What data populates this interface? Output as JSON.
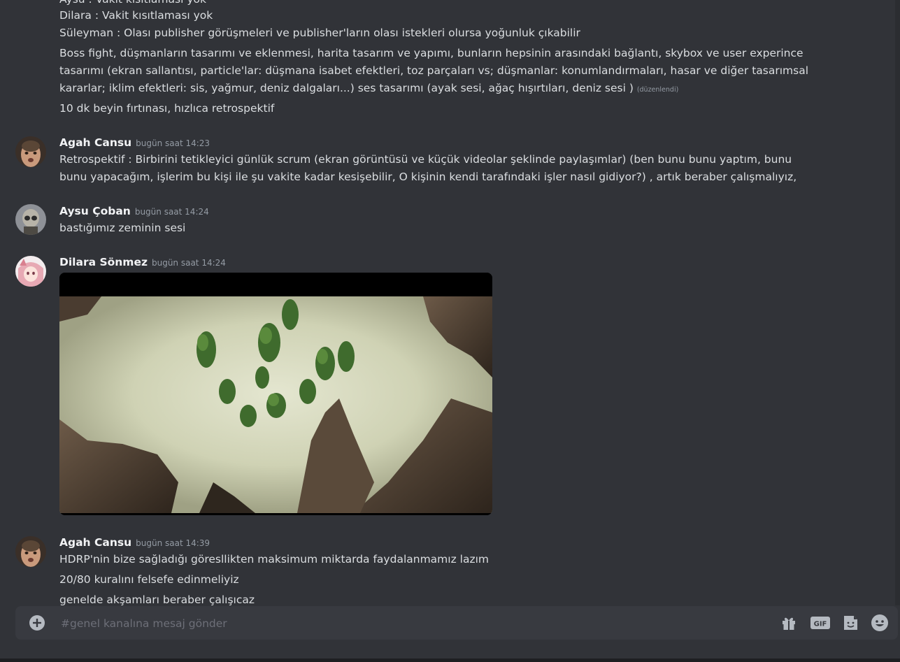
{
  "messages": {
    "cut_line": "Aysu : Vakit kısıtlaması yok",
    "cont_lines": [
      "Dilara : Vakit kısıtlaması yok",
      "Süleyman : Olası publisher görüşmeleri ve publisher'ların olası istekleri olursa yoğunluk çıkabilir"
    ],
    "boss_text": "Boss fight, düşmanların tasarımı ve eklenmesi, harita tasarım ve yapımı, bunların hepsinin arasındaki bağlantı, skybox ve user experince tasarımı (ekran sallantısı, particle'lar: düşmana isabet efektleri, toz parçaları vs; düşmanlar: konumlandırmaları, hasar ve diğer tasarımsal kararlar;  iklim efektleri: sis, yağmur, deniz dalgaları...) ses tasarımı (ayak sesi, ağaç hışırtıları, deniz sesi )",
    "edited_label": "(düzenlendi)",
    "brainstorm": "10 dk beyin fırtınası, hızlıca retrospektif",
    "m1": {
      "author": "Agah Cansu",
      "timestamp": "bugün saat 14:23",
      "text": "Retrospektif : Birbirini tetikleyici günlük scrum (ekran görüntüsü ve küçük videolar şeklinde paylaşımlar) (ben bunu bunu yaptım, bunu bunu yapacağım, işlerim bu kişi ile şu vakite kadar kesişebilir, O kişinin kendi tarafındaki işler nasıl gidiyor?) , artık beraber çalışmalıyız,"
    },
    "m2": {
      "author": "Aysu Çoban",
      "timestamp": "bugün saat 14:24",
      "text": "bastığımız zeminin sesi"
    },
    "m3": {
      "author": "Dilara Sönmez",
      "timestamp": "bugün saat 14:24"
    },
    "m4": {
      "author": "Agah Cansu",
      "timestamp": "bugün saat 14:39",
      "lines": [
        "HDRP'nin bize sağladığı göresllikten maksimum miktarda faydalanmamız lazım",
        "20/80 kuralını felsefe edinmeliyiz",
        "genelde akşamları beraber çalışıcaz"
      ]
    }
  },
  "composer": {
    "placeholder": "#genel kanalına mesaj gönder",
    "icons": [
      "plus-circle-icon",
      "gift-icon",
      "gif-icon",
      "sticker-icon",
      "emoji-icon"
    ],
    "gif_label": "GIF"
  },
  "colors": {
    "background": "#313338",
    "composer_bg": "#383a40",
    "text": "#dbdee1",
    "muted": "#949ba4",
    "author": "#f2f3f5"
  }
}
